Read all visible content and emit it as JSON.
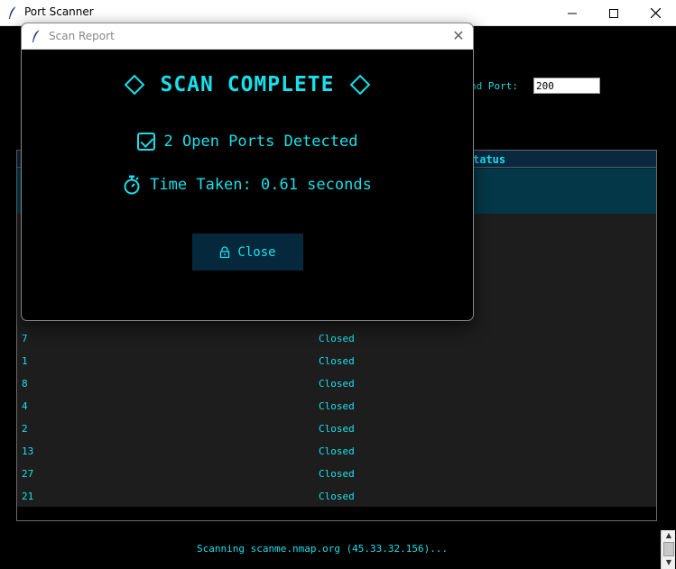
{
  "window": {
    "title": "Port Scanner"
  },
  "config": {
    "end_port_label": "nd Port:",
    "end_port_value": "200"
  },
  "table": {
    "status_header": "tatus",
    "rows": [
      {
        "port": "7",
        "status": "Closed"
      },
      {
        "port": "1",
        "status": "Closed"
      },
      {
        "port": "8",
        "status": "Closed"
      },
      {
        "port": "4",
        "status": "Closed"
      },
      {
        "port": "2",
        "status": "Closed"
      },
      {
        "port": "13",
        "status": "Closed"
      },
      {
        "port": "27",
        "status": "Closed"
      },
      {
        "port": "21",
        "status": "Closed"
      }
    ]
  },
  "status_bar": {
    "text": "Scanning scanme.nmap.org (45.33.32.156)..."
  },
  "dialog": {
    "title": "Scan Report",
    "heading": "SCAN COMPLETE",
    "open_ports_text": "2 Open Ports Detected",
    "time_text": "Time Taken: 0.61 seconds",
    "close_label": "Close"
  },
  "colors": {
    "accent": "#18e0ea",
    "background": "#000000",
    "button_bg": "#06283d",
    "selected_row": "#043848"
  },
  "icons": [
    "feather-icon",
    "minimize-icon",
    "maximize-icon",
    "close-icon",
    "diamond-icon",
    "checkbox-icon",
    "stopwatch-icon",
    "lock-icon"
  ]
}
